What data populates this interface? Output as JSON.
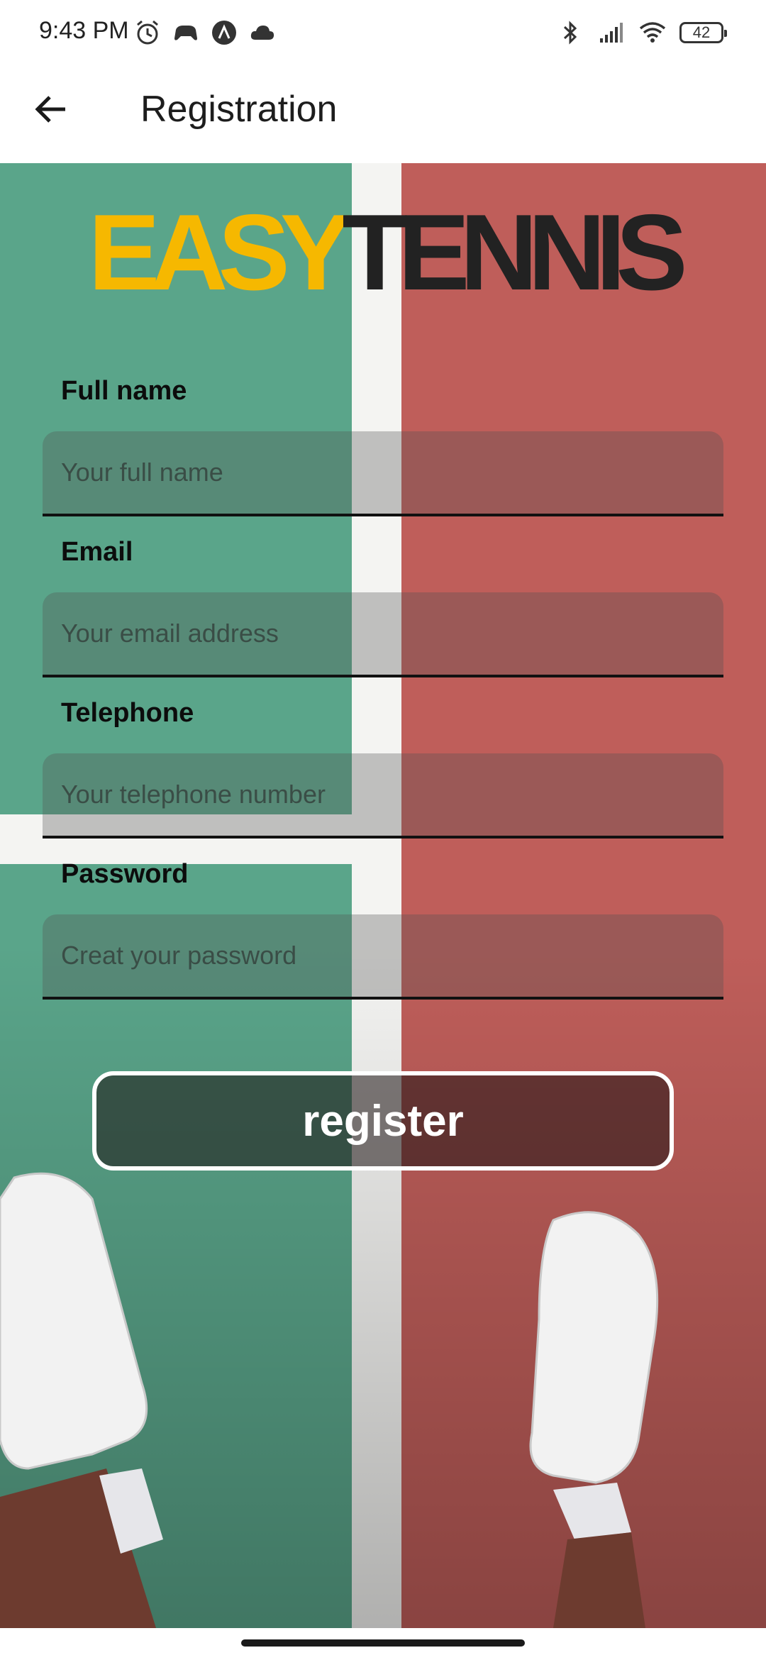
{
  "status_bar": {
    "time": "9:43 PM",
    "battery": "42",
    "left_icons": [
      "alarm-icon",
      "game-controller-icon",
      "arc-icon",
      "cloud-icon"
    ],
    "right_icons": [
      "bluetooth-icon",
      "signal-icon",
      "wifi-icon",
      "battery-icon"
    ]
  },
  "app_bar": {
    "title": "Registration",
    "back_icon": "arrow-left-icon"
  },
  "logo": {
    "part1": "EASY",
    "part2": "TENNIS",
    "colors": {
      "part1": "#f6b800",
      "part2": "#222222"
    }
  },
  "form": {
    "full_name": {
      "label": "Full name",
      "placeholder": "Your full name",
      "value": ""
    },
    "email": {
      "label": "Email",
      "placeholder": "Your email address",
      "value": ""
    },
    "telephone": {
      "label": "Telephone",
      "placeholder": "Your telephone number",
      "value": ""
    },
    "password": {
      "label": "Password",
      "placeholder": "Creat your password",
      "value": ""
    }
  },
  "register_button": {
    "label": "register"
  },
  "colors": {
    "court_green": "#5aa58a",
    "court_red": "#bf5e5a",
    "court_line": "#f4f4f2",
    "button_border": "#ffffff"
  }
}
